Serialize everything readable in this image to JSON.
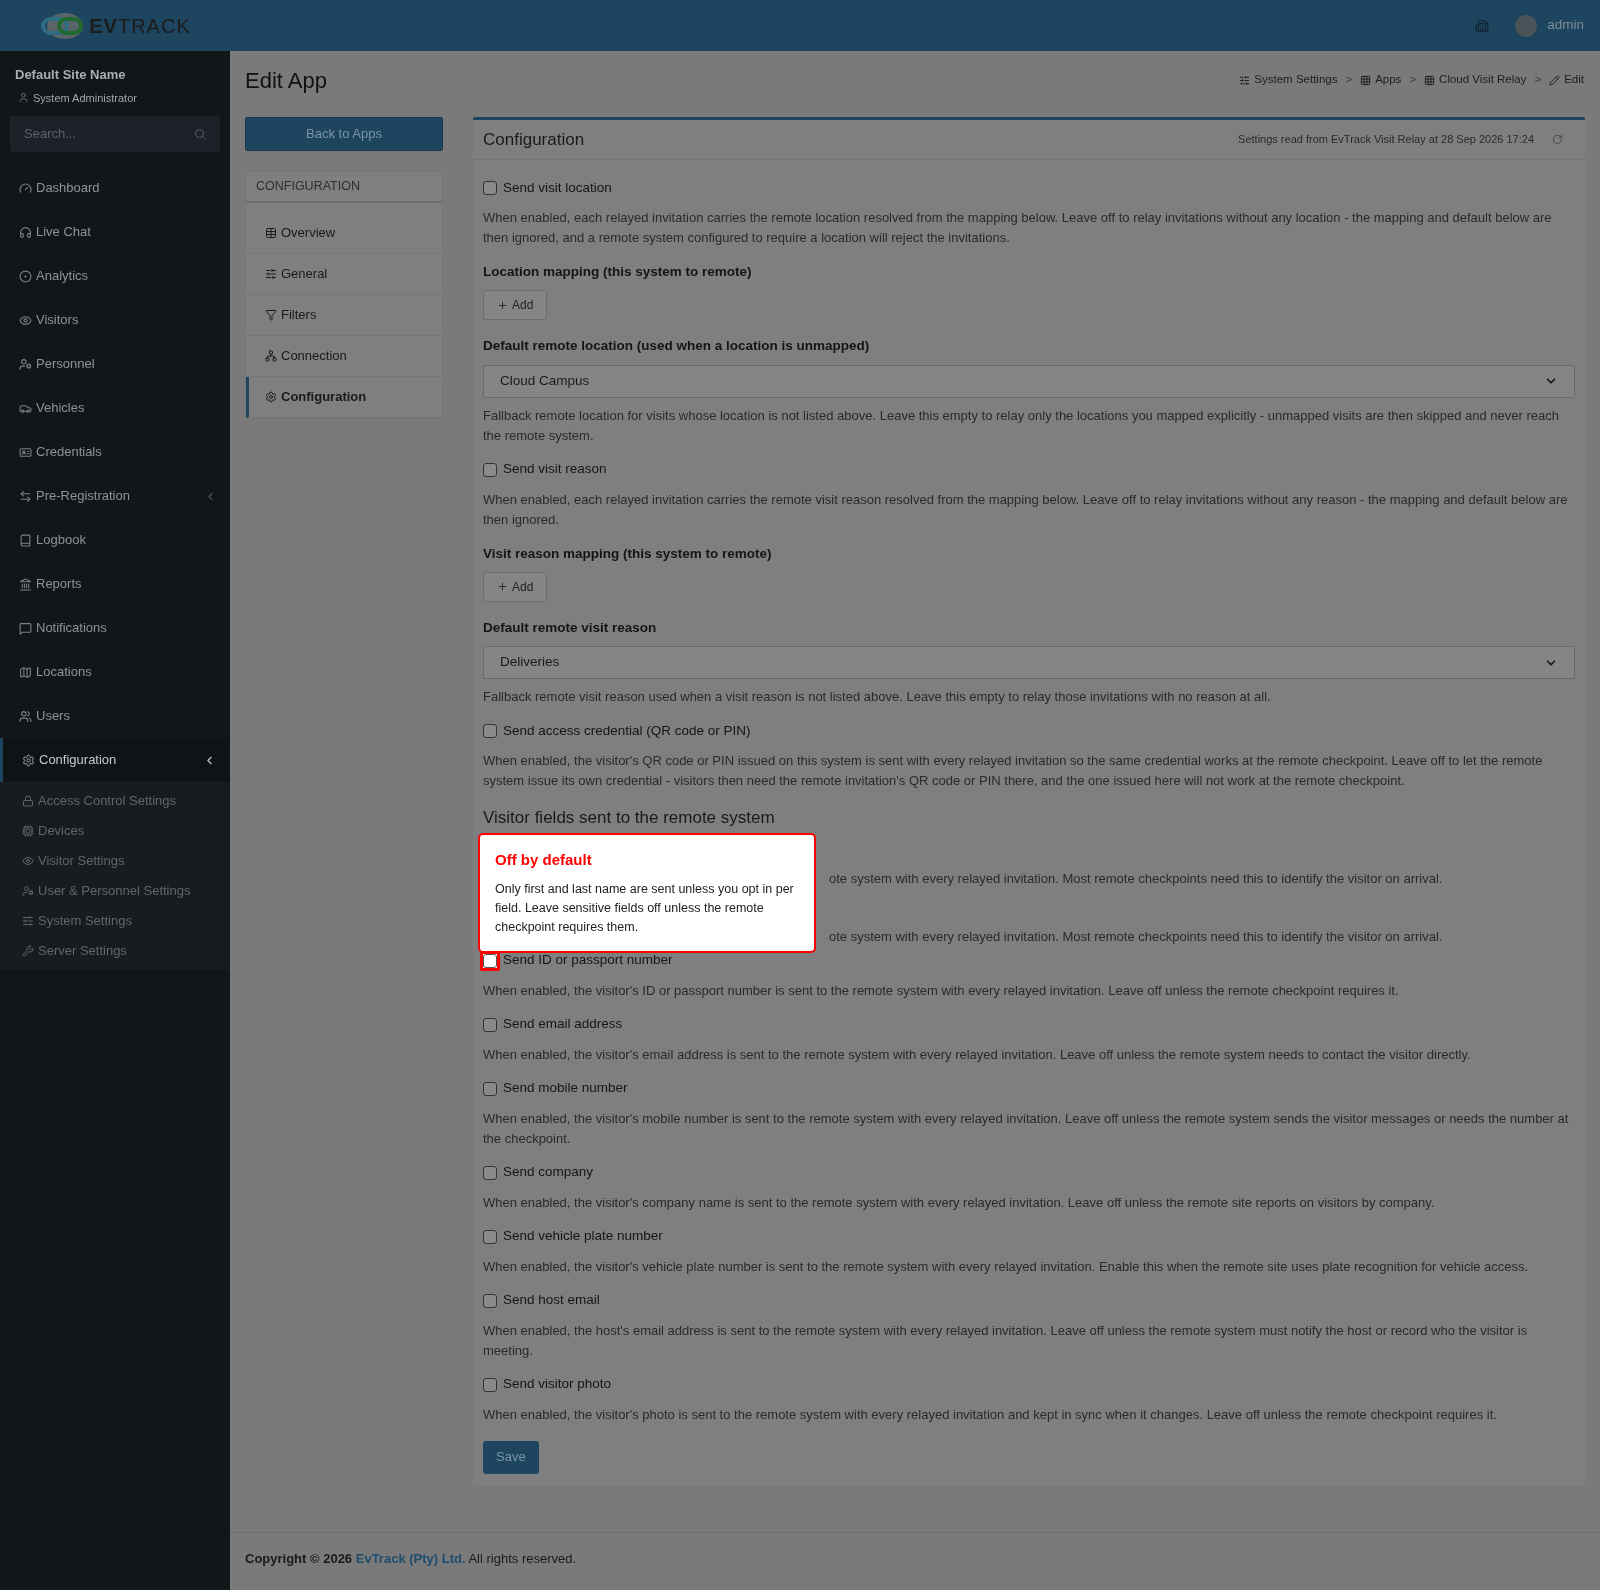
{
  "header": {
    "logo_bold": "EV",
    "logo_light": "TRACK",
    "user": "admin"
  },
  "sidebar": {
    "site_name": "Default Site Name",
    "role": "System Administrator",
    "search": {
      "placeholder": "Search..."
    },
    "items": [
      {
        "label": "Dashboard",
        "selected": false,
        "expandable": false
      },
      {
        "label": "Live Chat",
        "selected": false,
        "expandable": false
      },
      {
        "label": "Analytics",
        "selected": false,
        "expandable": false
      },
      {
        "label": "Visitors",
        "selected": false,
        "expandable": false
      },
      {
        "label": "Personnel",
        "selected": false,
        "expandable": false
      },
      {
        "label": "Vehicles",
        "selected": false,
        "expandable": false
      },
      {
        "label": "Credentials",
        "selected": false,
        "expandable": false
      },
      {
        "label": "Pre-Registration",
        "selected": false,
        "expandable": true,
        "expanded": false
      },
      {
        "label": "Logbook",
        "selected": false,
        "expandable": false
      },
      {
        "label": "Reports",
        "selected": false,
        "expandable": false
      },
      {
        "label": "Notifications",
        "selected": false,
        "expandable": false
      },
      {
        "label": "Locations",
        "selected": false,
        "expandable": false
      },
      {
        "label": "Users",
        "selected": false,
        "expandable": false
      },
      {
        "label": "Configuration",
        "selected": true,
        "expandable": true,
        "expanded": true,
        "children": [
          {
            "label": "Access Control Settings"
          },
          {
            "label": "Devices"
          },
          {
            "label": "Visitor Settings"
          },
          {
            "label": "User & Personnel Settings"
          },
          {
            "label": "System Settings"
          },
          {
            "label": "Server Settings"
          }
        ]
      }
    ]
  },
  "page": {
    "title": "Edit App",
    "breadcrumb_separator": ">",
    "breadcrumb": [
      {
        "label": "System Settings"
      },
      {
        "label": "Apps"
      },
      {
        "label": "Cloud Visit Relay"
      },
      {
        "label": "Edit"
      }
    ],
    "back_button": "Back to Apps"
  },
  "config_nav": {
    "heading": "CONFIGURATION",
    "items": [
      {
        "label": "Overview",
        "selected": false
      },
      {
        "label": "General",
        "selected": false
      },
      {
        "label": "Filters",
        "selected": false
      },
      {
        "label": "Connection",
        "selected": false
      },
      {
        "label": "Configuration",
        "selected": true
      }
    ]
  },
  "card": {
    "title": "Configuration",
    "status": "Settings read from EvTrack Visit Relay at 28 Sep 2026 17:24",
    "fields": [
      {
        "kind": "checkbox",
        "label": "Send visit location",
        "checked": false,
        "highlighted": false
      },
      {
        "kind": "description",
        "text": "When enabled, each relayed invitation carries the remote location resolved from the mapping below. Leave off to relay invitations without any location - the mapping and default below are then ignored, and a remote system configured to require a location will reject the invitations."
      },
      {
        "kind": "label",
        "text": "Location mapping (this system to remote)"
      },
      {
        "kind": "add",
        "label": "Add"
      },
      {
        "kind": "label",
        "text": "Default remote location (used when a location is unmapped)"
      },
      {
        "kind": "select",
        "value": "Cloud Campus"
      },
      {
        "kind": "description",
        "text": "Fallback remote location for visits whose location is not listed above. Leave this empty to relay only the locations you mapped explicitly - unmapped visits are then skipped and never reach the remote system."
      },
      {
        "kind": "checkbox",
        "label": "Send visit reason",
        "checked": false,
        "highlighted": false
      },
      {
        "kind": "description",
        "text": "When enabled, each relayed invitation carries the remote visit reason resolved from the mapping below. Leave off to relay invitations without any reason - the mapping and default below are then ignored."
      },
      {
        "kind": "label",
        "text": "Visit reason mapping (this system to remote)"
      },
      {
        "kind": "add",
        "label": "Add"
      },
      {
        "kind": "label",
        "text": "Default remote visit reason"
      },
      {
        "kind": "select",
        "value": "Deliveries"
      },
      {
        "kind": "description",
        "text": "Fallback remote visit reason used when a visit reason is not listed above. Leave this empty to relay those invitations with no reason at all."
      },
      {
        "kind": "checkbox",
        "label": "Send access credential (QR code or PIN)",
        "checked": false,
        "highlighted": false
      },
      {
        "kind": "description",
        "text": "When enabled, the visitor's QR code or PIN issued on this system is sent with every relayed invitation so the same credential works at the remote checkpoint. Leave off to let the remote system issue its own credential - visitors then need the remote invitation's QR code or PIN there, and the one issued here will not work at the remote checkpoint."
      },
      {
        "kind": "section",
        "text": "Visitor fields sent to the remote system"
      },
      {
        "kind": "fragment",
        "text": "ote system with every relayed invitation. Most remote checkpoints need this to identify the visitor on arrival."
      },
      {
        "kind": "fragment",
        "text": "ote system with every relayed invitation. Most remote checkpoints need this to identify the visitor on arrival."
      },
      {
        "kind": "checkbox",
        "label": "Send ID or passport number",
        "checked": false,
        "highlighted": true
      },
      {
        "kind": "description",
        "text": "When enabled, the visitor's ID or passport number is sent to the remote system with every relayed invitation. Leave off unless the remote checkpoint requires it."
      },
      {
        "kind": "checkbox",
        "label": "Send email address",
        "checked": false,
        "highlighted": false
      },
      {
        "kind": "description",
        "text": "When enabled, the visitor's email address is sent to the remote system with every relayed invitation. Leave off unless the remote system needs to contact the visitor directly."
      },
      {
        "kind": "checkbox",
        "label": "Send mobile number",
        "checked": false,
        "highlighted": false
      },
      {
        "kind": "description",
        "text": "When enabled, the visitor's mobile number is sent to the remote system with every relayed invitation. Leave off unless the remote system sends the visitor messages or needs the number at the checkpoint."
      },
      {
        "kind": "checkbox",
        "label": "Send company",
        "checked": false,
        "highlighted": false
      },
      {
        "kind": "description",
        "text": "When enabled, the visitor's company name is sent to the remote system with every relayed invitation. Leave off unless the remote site reports on visitors by company."
      },
      {
        "kind": "checkbox",
        "label": "Send vehicle plate number",
        "checked": false,
        "highlighted": false
      },
      {
        "kind": "description",
        "text": "When enabled, the visitor's vehicle plate number is sent to the remote system with every relayed invitation. Enable this when the remote site uses plate recognition for vehicle access."
      },
      {
        "kind": "checkbox",
        "label": "Send host email",
        "checked": false,
        "highlighted": false
      },
      {
        "kind": "description",
        "text": "When enabled, the host's email address is sent to the remote system with every relayed invitation. Leave off unless the remote system must notify the host or record who the visitor is meeting."
      },
      {
        "kind": "checkbox",
        "label": "Send visitor photo",
        "checked": false,
        "highlighted": false
      },
      {
        "kind": "description",
        "text": "When enabled, the visitor's photo is sent to the remote system with every relayed invitation and kept in sync when it changes. Leave off unless the remote checkpoint requires it."
      }
    ],
    "save_button": "Save"
  },
  "tooltip": {
    "title": "Off by default",
    "body": "Only first and last name are sent unless you opt in per field. Leave sensitive fields off unless the remote checkpoint requires them."
  },
  "footer": {
    "prefix": "Copyright © 2026",
    "company": "EvTrack (Pty) Ltd.",
    "suffix": "All rights reserved."
  }
}
